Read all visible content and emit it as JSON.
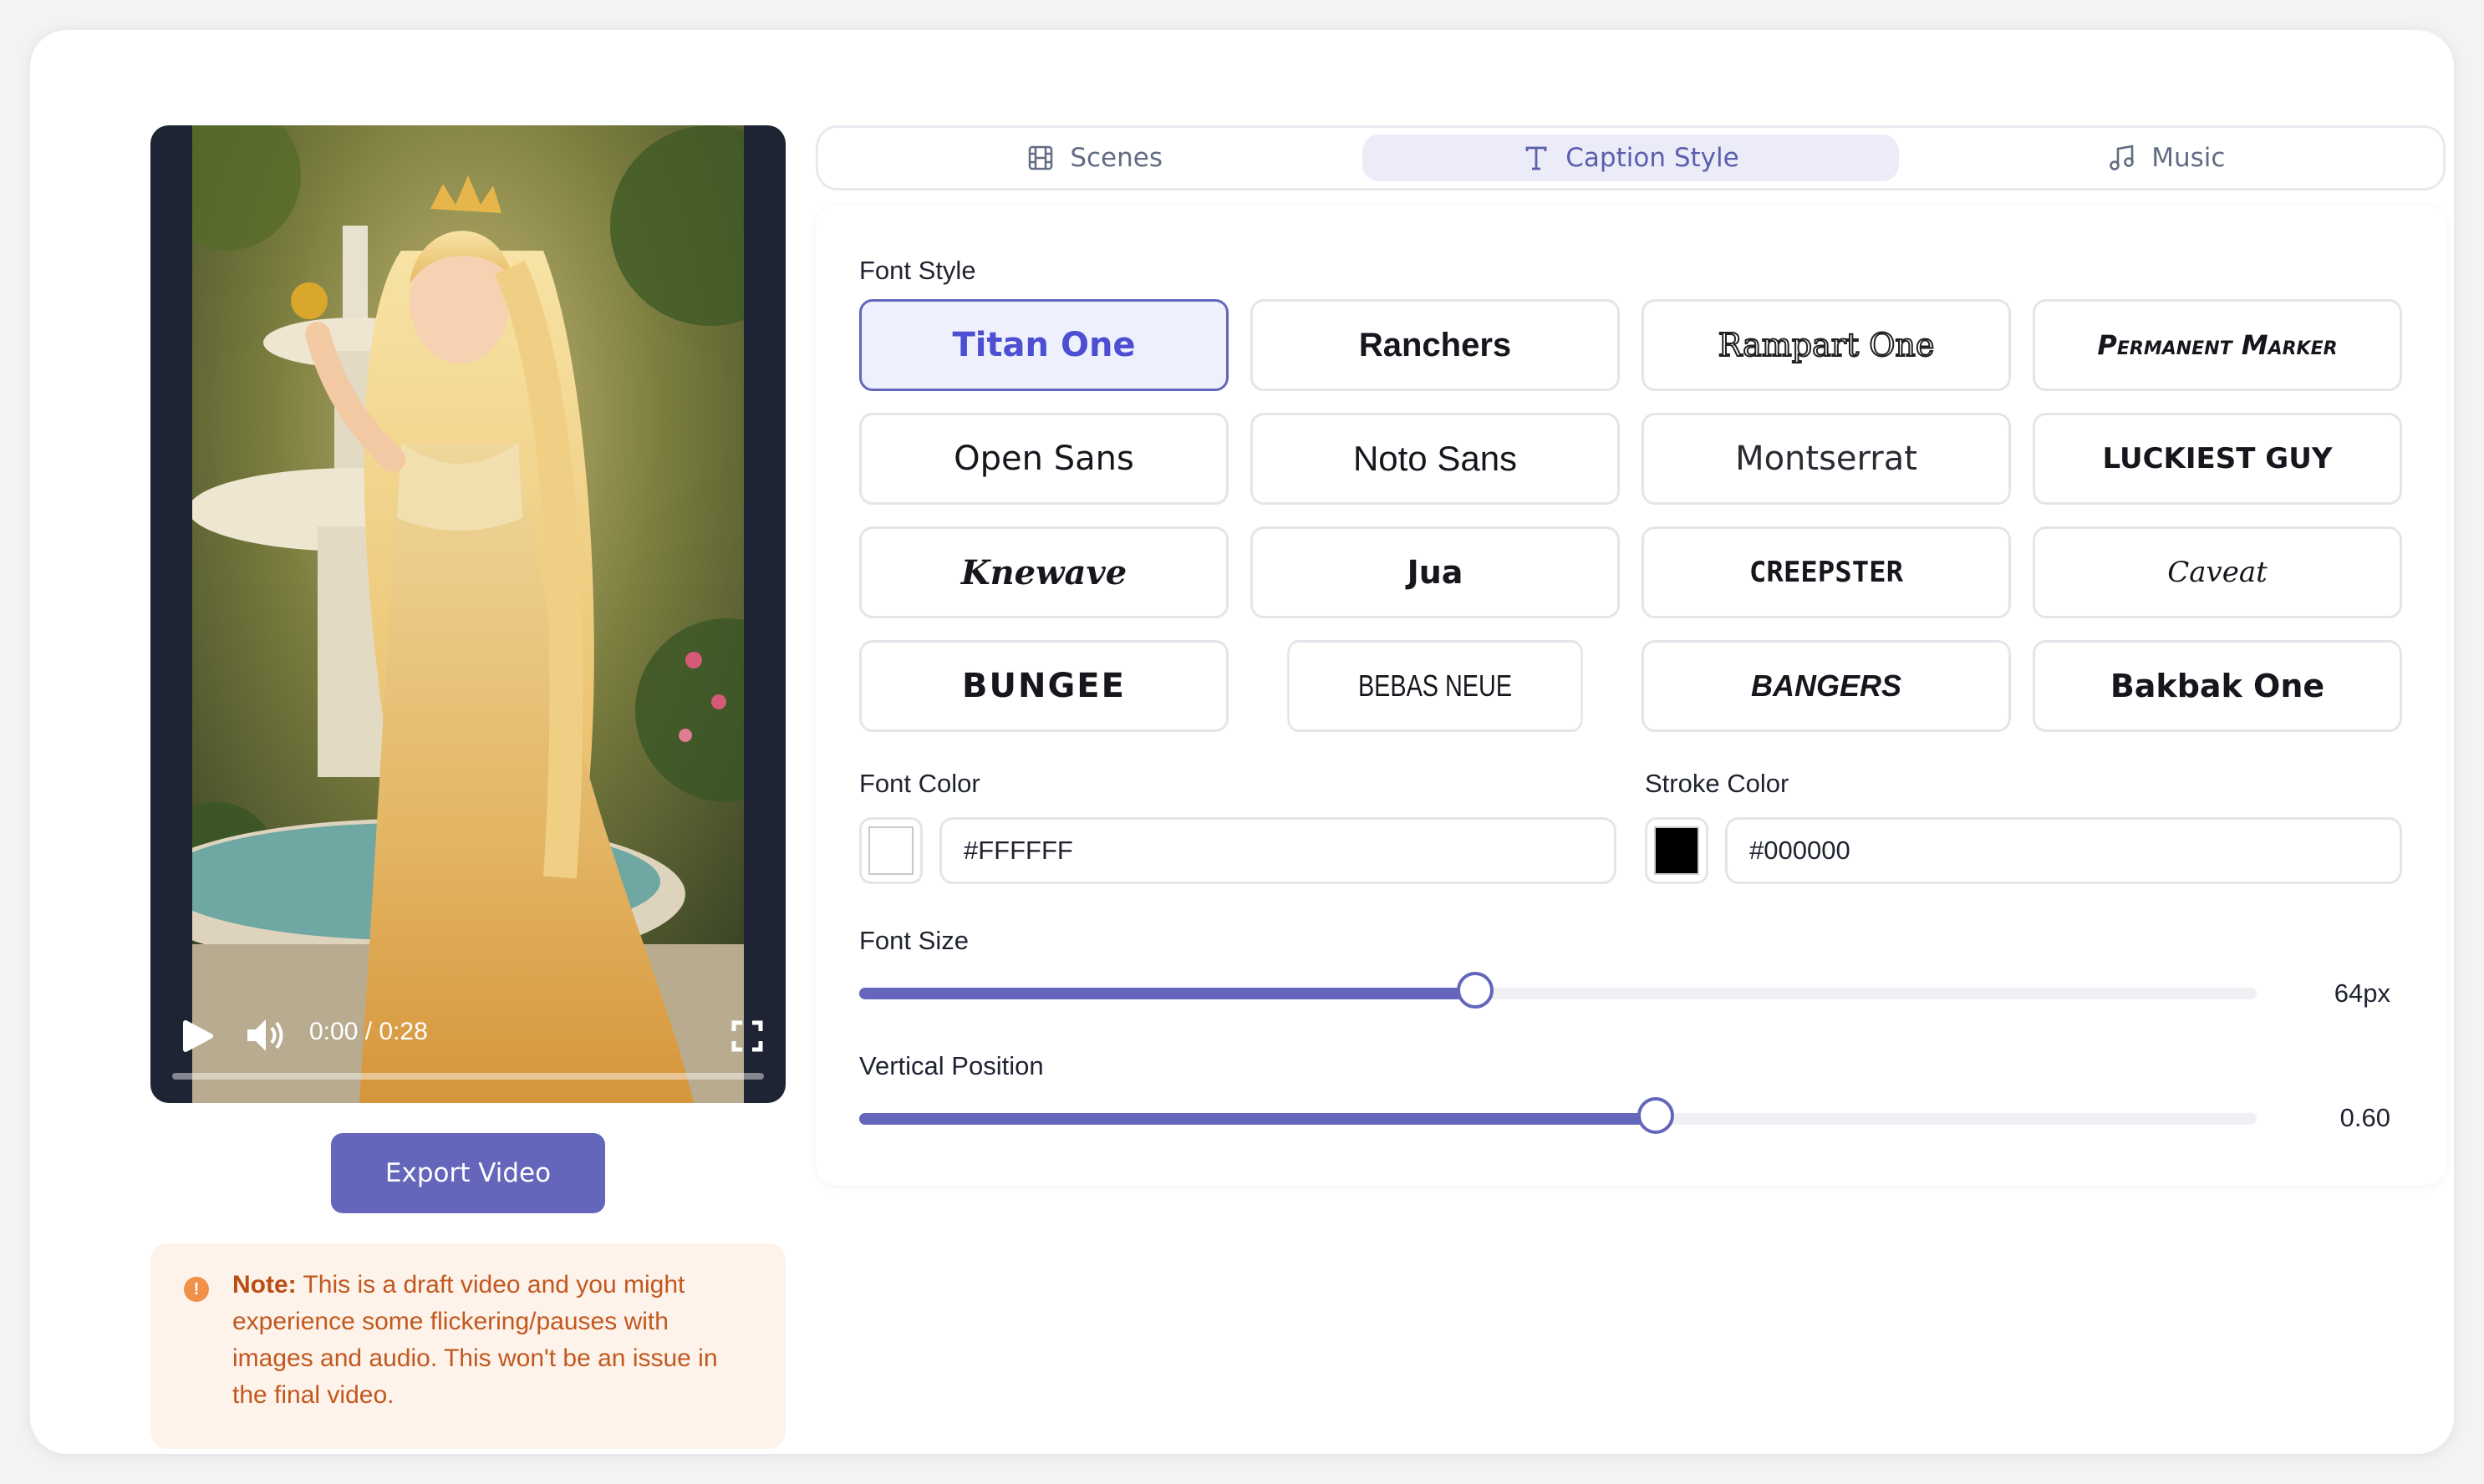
{
  "player": {
    "time": "0:00 / 0:28",
    "progress": 0.0
  },
  "export_label": "Export Video",
  "note": {
    "prefix": "Note:",
    "text": " This is a draft video and you might experience some flickering/pauses with images and audio. This won't be an issue in the final video."
  },
  "tabs": [
    {
      "label": "Scenes",
      "icon": "film-icon"
    },
    {
      "label": "Caption Style",
      "icon": "text-icon",
      "active": true
    },
    {
      "label": "Music",
      "icon": "music-note-icon"
    }
  ],
  "font_style": {
    "label": "Font Style",
    "selected": "Titan One",
    "options": [
      "Titan One",
      "Ranchers",
      "Rampart One",
      "Permanent Marker",
      "Open Sans",
      "Noto Sans",
      "Montserrat",
      "Luckiest Guy",
      "Knewave",
      "Jua",
      "Creepster",
      "Caveat",
      "BUNGEE",
      "BEBAS NEUE",
      "BANGERS",
      "Bakbak One"
    ]
  },
  "font_color": {
    "label": "Font Color",
    "value": "#FFFFFF",
    "swatch": "#FFFFFF"
  },
  "stroke_color": {
    "label": "Stroke Color",
    "value": "#000000",
    "swatch": "#000000"
  },
  "font_size": {
    "label": "Font Size",
    "value_text": "64px",
    "fraction": 0.441
  },
  "vertical_position": {
    "label": "Vertical Position",
    "value_text": "0.60",
    "fraction": 0.57
  },
  "colors": {
    "accent": "#6466bc",
    "note_bg": "#fdf3ea",
    "note_text": "#c2581f"
  }
}
